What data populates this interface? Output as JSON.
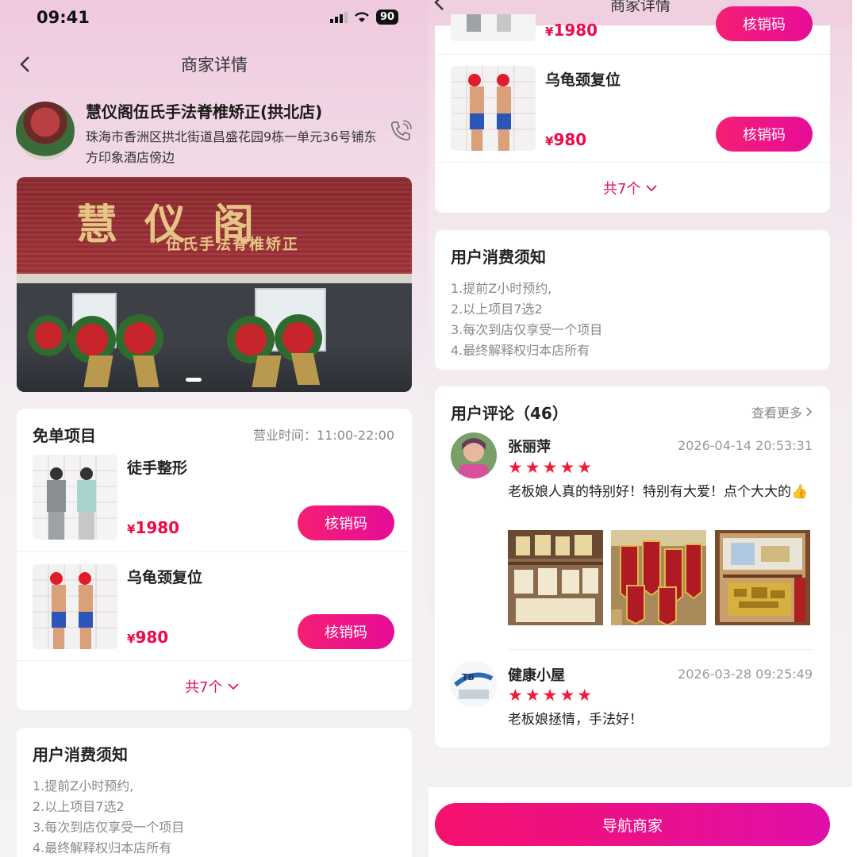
{
  "status_bar": {
    "time": "09:41",
    "battery": "90"
  },
  "header": {
    "title": "商家详情"
  },
  "merchant": {
    "name": "慧仪阁伍氏手法脊椎矫正(拱北店)",
    "address": "珠海市香洲区拱北街道昌盛花园9栋一单元36号铺东方印象酒店傍边",
    "sign_title": "慧仪阁",
    "sign_subtitle": "伍氏手法脊椎矫正"
  },
  "free_section": {
    "title": "免单项目",
    "hours": "营业时间：11:00-22:00",
    "items": [
      {
        "name": "徒手整形",
        "price_symbol": "¥",
        "price": "1980",
        "button": "核销码"
      },
      {
        "name": "乌龟颈复位",
        "price_symbol": "¥",
        "price": "980",
        "button": "核销码"
      }
    ],
    "more": "共7个"
  },
  "notice": {
    "title": "用户消费须知",
    "lines": [
      "1.提前Z小时预约,",
      "2.以上项目7选2",
      "3.每次到店仅享受一个项目",
      "4.最终解释权归本店所有"
    ]
  },
  "reviews": {
    "title": "用户评论（46）",
    "see_more": "查看更多",
    "items": [
      {
        "name": "张丽萍",
        "date": "2026-04-14 20:53:31",
        "stars": "★★★★★",
        "text": "老板娘人真的特别好！特别有大爱！点个大大的👍"
      },
      {
        "name": "健康小屋",
        "date": "2026-03-28 09:25:49",
        "stars": "★★★★★",
        "text": "老板娘拯情，手法好！"
      }
    ]
  },
  "bottom": {
    "nav_button": "导航商家"
  },
  "colors": {
    "accent": "#e60c98",
    "price": "#ef0a4a",
    "star": "#f0193a"
  }
}
